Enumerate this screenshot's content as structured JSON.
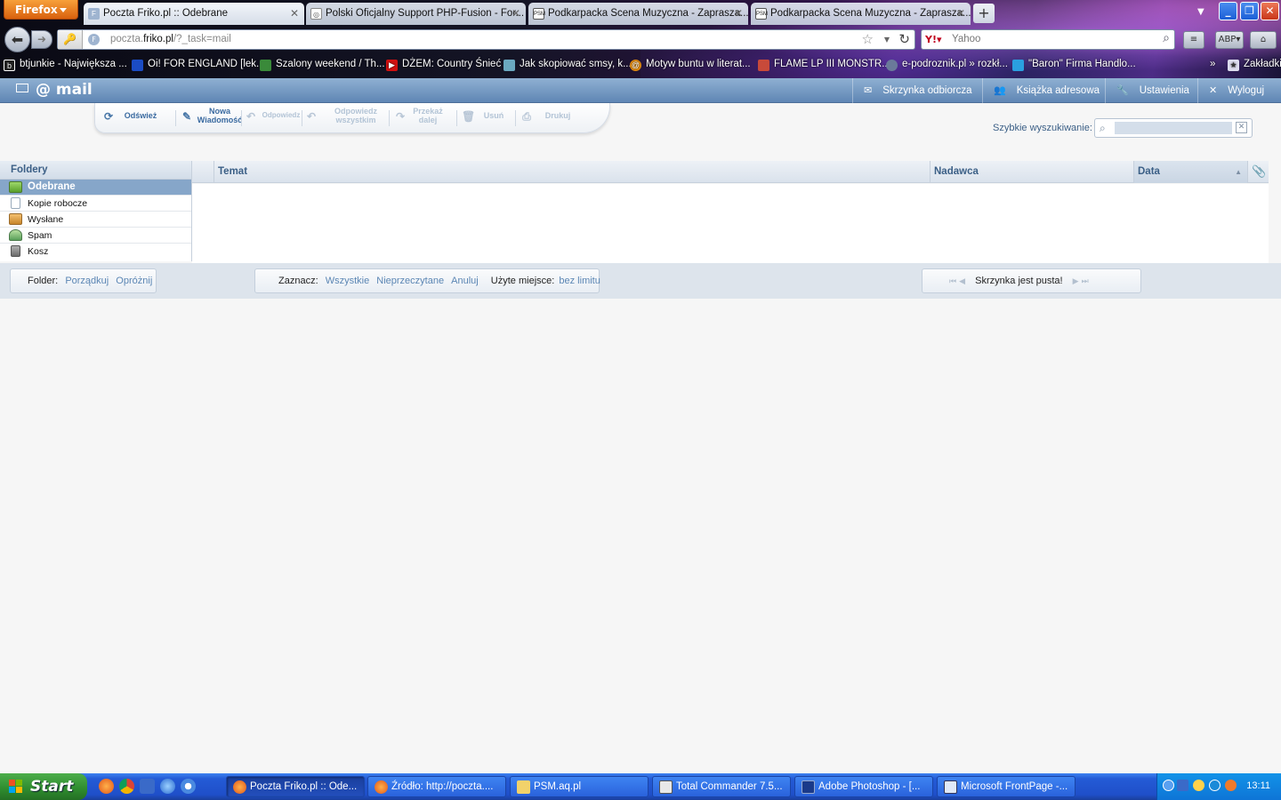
{
  "browser": {
    "menu_button": "Firefox",
    "tabs": [
      {
        "label": "Poczta Friko.pl :: Odebrane",
        "active": true
      },
      {
        "label": "Polski Oficjalny Support PHP-Fusion - For...",
        "active": false
      },
      {
        "label": "Podkarpacka Scena Muzyczna - Zaprasza...",
        "active": false
      },
      {
        "label": "Podkarpacka Scena Muzyczna - Zaprasza...",
        "active": false
      }
    ],
    "url_prefix": "poczta.",
    "url_domain": "friko.pl",
    "url_suffix": "/?_task=mail",
    "search_engine": "Yahoo",
    "bookmarks": [
      "btjunkie - Największa ...",
      "Oi! FOR ENGLAND [lek...",
      "Szalony weekend / Th...",
      "DŻEM: Country Śnieć",
      "Jak skopiować smsy, k...",
      "Motyw buntu w literat...",
      "FLAME LP III MONSTR...",
      "e-podroznik.pl » rozkł...",
      "\"Baron\" Firma Handlo...",
      "Zakładki"
    ]
  },
  "app": {
    "logo": "@ mail",
    "topnav": [
      {
        "label": "Skrzynka odbiorcza",
        "icon": "envelope-icon"
      },
      {
        "label": "Książka adresowa",
        "icon": "contacts-icon"
      },
      {
        "label": "Ustawienia",
        "icon": "wrench-icon"
      },
      {
        "label": "Wyloguj",
        "icon": "close-icon"
      }
    ],
    "toolbar": {
      "refresh": "Odśwież",
      "new_message": "Nowa Wiadomość",
      "reply": "Odpowiedz",
      "reply_all": "Odpowiedz wszystkim",
      "forward": "Przekaż dalej",
      "delete": "Usuń",
      "print": "Drukuj"
    },
    "quick_search_label": "Szybkie wyszukiwanie:",
    "quick_search_value": "",
    "folders": {
      "header": "Foldery",
      "items": [
        {
          "label": "Odebrane",
          "selected": true,
          "icon": "inbox-icon"
        },
        {
          "label": "Kopie robocze",
          "selected": false,
          "icon": "drafts-icon"
        },
        {
          "label": "Wysłane",
          "selected": false,
          "icon": "sent-icon"
        },
        {
          "label": "Spam",
          "selected": false,
          "icon": "spam-icon"
        },
        {
          "label": "Kosz",
          "selected": false,
          "icon": "trash-icon"
        }
      ]
    },
    "columns": {
      "subject": "Temat",
      "sender": "Nadawca",
      "date": "Data"
    },
    "footer": {
      "folder_label": "Folder:",
      "folder_compact": "Porządkuj",
      "folder_empty": "Opróżnij",
      "select_label": "Zaznacz:",
      "select_all": "Wszystkie",
      "select_unread": "Nieprzeczytane",
      "select_none": "Anuluj",
      "quota_label": "Użyte miejsce:",
      "quota_value": "bez limitu",
      "status": "Skrzynka jest pusta!"
    }
  },
  "taskbar": {
    "start": "Start",
    "tasks": [
      {
        "label": "Poczta Friko.pl :: Ode...",
        "active": true
      },
      {
        "label": "Źródło: http://poczta....",
        "active": false
      },
      {
        "label": "PSM.aq.pl",
        "active": false
      },
      {
        "label": "Total Commander 7.5...",
        "active": false
      },
      {
        "label": "Adobe Photoshop - [...",
        "active": false
      },
      {
        "label": "Microsoft FrontPage -...",
        "active": false
      }
    ],
    "clock": "13:11"
  },
  "colors": {
    "accent": "#5f86b4",
    "selected_folder": "#86a6c9",
    "link": "#5b86b4",
    "taskbar": "#245bd6",
    "start": "#2e8b2e"
  }
}
